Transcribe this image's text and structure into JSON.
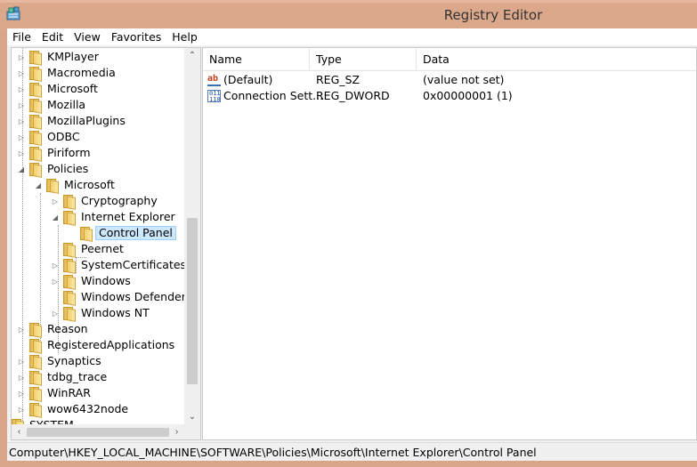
{
  "window": {
    "title": "Registry Editor",
    "app_icon": "regedit-icon"
  },
  "menu": [
    "File",
    "Edit",
    "View",
    "Favorites",
    "Help"
  ],
  "tree": {
    "items": [
      {
        "label": "KMPlayer",
        "expander": "▷"
      },
      {
        "label": "Macromedia",
        "expander": "▷"
      },
      {
        "label": "Microsoft",
        "expander": "▷"
      },
      {
        "label": "Mozilla",
        "expander": "▷"
      },
      {
        "label": "MozillaPlugins",
        "expander": "▷"
      },
      {
        "label": "ODBC",
        "expander": "▷"
      },
      {
        "label": "Piriform",
        "expander": "▷"
      },
      {
        "label": "Policies",
        "expander": "◢"
      },
      {
        "label": "Microsoft",
        "expander": "◢"
      },
      {
        "label": "Cryptography",
        "expander": "▷"
      },
      {
        "label": "Internet Explorer",
        "expander": "◢"
      },
      {
        "label": "Control Panel",
        "expander": ""
      },
      {
        "label": "Peernet",
        "expander": ""
      },
      {
        "label": "SystemCertificates",
        "expander": "▷"
      },
      {
        "label": "Windows",
        "expander": "▷"
      },
      {
        "label": "Windows Defender",
        "expander": ""
      },
      {
        "label": "Windows NT",
        "expander": "▷"
      },
      {
        "label": "Reason",
        "expander": "▷"
      },
      {
        "label": "RegisteredApplications",
        "expander": ""
      },
      {
        "label": "Synaptics",
        "expander": "▷"
      },
      {
        "label": "tdbg_trace",
        "expander": "▷"
      },
      {
        "label": "WinRAR",
        "expander": "▷"
      },
      {
        "label": "wow6432node",
        "expander": "▷"
      },
      {
        "label": "SYSTEM",
        "expander": "▷"
      }
    ],
    "selected": "Control Panel"
  },
  "values": {
    "columns": [
      "Name",
      "Type",
      "Data"
    ],
    "rows": [
      {
        "icon": "string-value-icon",
        "icon_text": "ab",
        "name": "(Default)",
        "type": "REG_SZ",
        "data": "(value not set)"
      },
      {
        "icon": "dword-value-icon",
        "icon_text": "011\n110",
        "name": "Connection Sett...",
        "type": "REG_DWORD",
        "data": "0x00000001 (1)"
      }
    ]
  },
  "statusbar": {
    "path": "Computer\\HKEY_LOCAL_MACHINE\\SOFTWARE\\Policies\\Microsoft\\Internet Explorer\\Control Panel"
  }
}
